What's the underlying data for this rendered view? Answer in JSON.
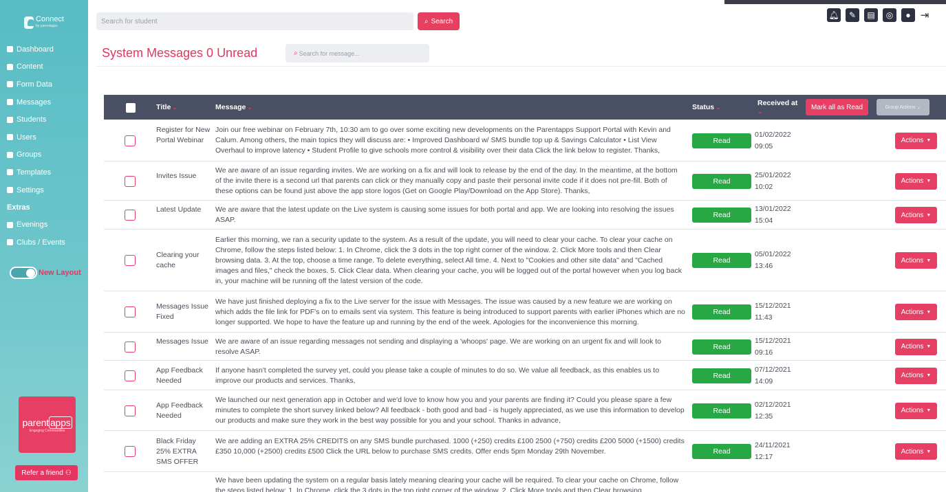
{
  "app": {
    "logo_text": "Connect",
    "logo_subtext": "by parentapps"
  },
  "sidebar": {
    "items": [
      {
        "label": "Dashboard",
        "icon": "dashboard-icon"
      },
      {
        "label": "Content",
        "icon": "document-icon"
      },
      {
        "label": "Form Data",
        "icon": "sitemap-icon"
      },
      {
        "label": "Messages",
        "icon": "envelope-icon"
      },
      {
        "label": "Students",
        "icon": "student-icon"
      },
      {
        "label": "Users",
        "icon": "user-icon"
      },
      {
        "label": "Groups",
        "icon": "group-icon"
      },
      {
        "label": "Templates",
        "icon": "folder-icon"
      },
      {
        "label": "Settings",
        "icon": "gear-icon"
      }
    ],
    "extras_heading": "Extras",
    "extras": [
      {
        "label": "Evenings",
        "icon": "people-icon"
      },
      {
        "label": "Clubs / Events",
        "icon": "calendar-icon"
      }
    ],
    "toggle_label": "New Layout",
    "brand": {
      "name_prefix": "parent",
      "name_box": "apps",
      "tagline": "Engaging Communities"
    },
    "refer_label": "Refer a friend"
  },
  "topbar": {
    "search_placeholder": "Search for student",
    "search_button": "Search",
    "icons": [
      "bell-icon",
      "user-edit-icon",
      "id-card-icon",
      "headset-icon",
      "profile-icon",
      "logout-icon"
    ]
  },
  "header": {
    "title": "System Messages 0 Unread",
    "search_placeholder": "Search for message..."
  },
  "table": {
    "columns": {
      "title": "Title",
      "message": "Message",
      "status": "Status",
      "received": "Received at"
    },
    "mark_all": "Mark all as Read",
    "group_actions": "Group Actions",
    "actions_label": "Actions",
    "rows": [
      {
        "title": "Register for New Portal Webinar",
        "message": "Join our free webinar on February 7th, 10:30 am to go over some exciting new developments on the Parentapps Support Portal with Kevin and Calum. Among others, the main topics they will discuss are: • Improved Dashboard w/ SMS bundle top up & Savings Calculator • List View Overhaul to improve latency • Student Profile to give schools more control & visibility over their data Click the link below to register. Thanks,",
        "status": "Read",
        "date": "01/02/2022",
        "time": "09:05"
      },
      {
        "title": "Invites Issue",
        "message": "We are aware of an issue regarding invites. We are working on a fix and will look to release by the end of the day. In the meantime, at the bottom of the invite there is a second url that parents can click or they manually copy and paste their personal invite code if it does not pre-fill. Both of these options can be found just above the app store logos (Get on Google Play/Download on the App Store). Thanks,",
        "status": "Read",
        "date": "25/01/2022",
        "time": "10:02"
      },
      {
        "title": "Latest Update",
        "message": "We are aware that the latest update on the Live system is causing some issues for both portal and app. We are looking into resolving the issues ASAP.",
        "status": "Read",
        "date": "13/01/2022",
        "time": "15:04"
      },
      {
        "title": "Clearing your cache",
        "message": "Earlier this morning, we ran a security update to the system. As a result of the update, you will need to clear your cache. To clear your cache on Chrome, follow the steps listed below: 1. In Chrome, click the 3 dots in the top right corner of the window. 2. Click More tools and then Clear browsing data. 3. At the top, choose a time range. To delete everything, select All time. 4. Next to \"Cookies and other site data\" and \"Cached images and files,\" check the boxes. 5. Click Clear data. When clearing your cache, you will be logged out of the portal however when you log back in, your machine will be running off the latest version of the code.",
        "status": "Read",
        "date": "05/01/2022",
        "time": "13:46"
      },
      {
        "title": "Messages Issue Fixed",
        "message": "We have just finished deploying a fix to the Live server for the issue with Messages. The issue was caused by a new feature we are working on which adds the file link for PDF's on to emails sent via system. This feature is being introduced to support parents with earlier iPhones which are no longer supported. We hope to have the feature up and running by the end of the week. Apologies for the inconvenience this morning.",
        "status": "Read",
        "date": "15/12/2021",
        "time": "11:43"
      },
      {
        "title": "Messages Issue",
        "message": "We are aware of an issue regarding messages not sending and displaying a 'whoops' page. We are working on an urgent fix and will look to resolve ASAP.",
        "status": "Read",
        "date": "15/12/2021",
        "time": "09:16"
      },
      {
        "title": "App Feedback Needed",
        "message": "If anyone hasn't completed the survey yet, could you please take a couple of minutes to do so. We value all feedback, as this enables us to improve our products and services. Thanks,",
        "status": "Read",
        "date": "07/12/2021",
        "time": "14:09"
      },
      {
        "title": "App Feedback Needed",
        "message": "We launched our next generation app in October and we'd love to know how you and your parents are finding it? Could you please spare a few minutes to complete the short survey linked below? All feedback - both good and bad - is hugely appreciated, as we use this information to develop our products and make sure they work in the best way possible for you and your school. Thanks in advance,",
        "status": "Read",
        "date": "02/12/2021",
        "time": "12:35"
      },
      {
        "title": "Black Friday 25% EXTRA SMS OFFER",
        "message": "We are adding an EXTRA 25% CREDITS on any SMS bundle purchased. 1000 (+250) credits £100 2500 (+750) credits £200 5000 (+1500) credits £350 10,000 (+2500) credits £500 Click the URL below to purchase SMS credits. Offer ends 5pm Monday 29th November.",
        "status": "Read",
        "date": "24/11/2021",
        "time": "12:17"
      },
      {
        "title": "",
        "message": "We have been updating the system on a regular basis lately meaning clearing your cache will be required. To clear your cache on Chrome, follow the steps listed below: 1. In Chrome, click the 3 dots in the top right corner of the window. 2. Click More tools and then Clear browsing",
        "status": "",
        "date": "",
        "time": ""
      }
    ]
  }
}
